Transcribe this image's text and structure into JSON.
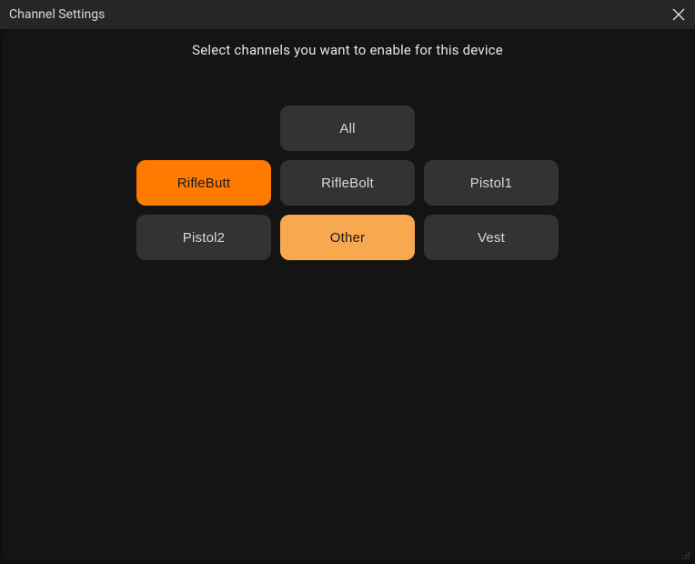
{
  "window": {
    "title": "Channel Settings"
  },
  "instruction": "Select channels you want to enable for this device",
  "channels": {
    "all": {
      "label": "All",
      "state": "off"
    },
    "rifleButt": {
      "label": "RifleButt",
      "state": "strong"
    },
    "rifleBolt": {
      "label": "RifleBolt",
      "state": "off"
    },
    "pistol1": {
      "label": "Pistol1",
      "state": "off"
    },
    "pistol2": {
      "label": "Pistol2",
      "state": "off"
    },
    "other": {
      "label": "Other",
      "state": "soft"
    },
    "vest": {
      "label": "Vest",
      "state": "off"
    }
  },
  "colors": {
    "accent": "#ff7a00",
    "accentSoft": "#f8a84f",
    "buttonBg": "#333333",
    "panelBg": "#141414",
    "titlebarBg": "#262626"
  }
}
